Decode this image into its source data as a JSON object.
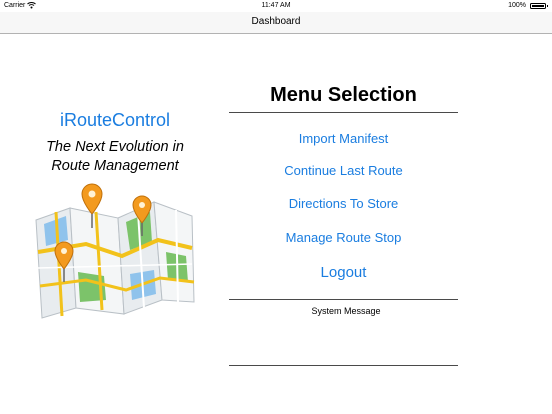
{
  "status_bar": {
    "carrier": "Carrier",
    "time": "11:47 AM",
    "battery": "100%"
  },
  "nav": {
    "title": "Dashboard"
  },
  "branding": {
    "app_name": "iRouteControl",
    "tagline_line1": "The Next Evolution in",
    "tagline_line2": "Route Management"
  },
  "menu": {
    "title": "Menu Selection",
    "import_manifest": "Import Manifest",
    "continue_last_route": "Continue Last Route",
    "directions_to_store": "Directions To Store",
    "manage_route_stop": "Manage Route Stop",
    "logout": "Logout"
  },
  "messages": {
    "system_message_label": "System Message"
  },
  "colors": {
    "accent": "#1a7de0",
    "pin": "#f39a1e"
  },
  "icons": [
    "wifi-icon",
    "battery-icon",
    "map-icon",
    "location-pin-icon"
  ]
}
